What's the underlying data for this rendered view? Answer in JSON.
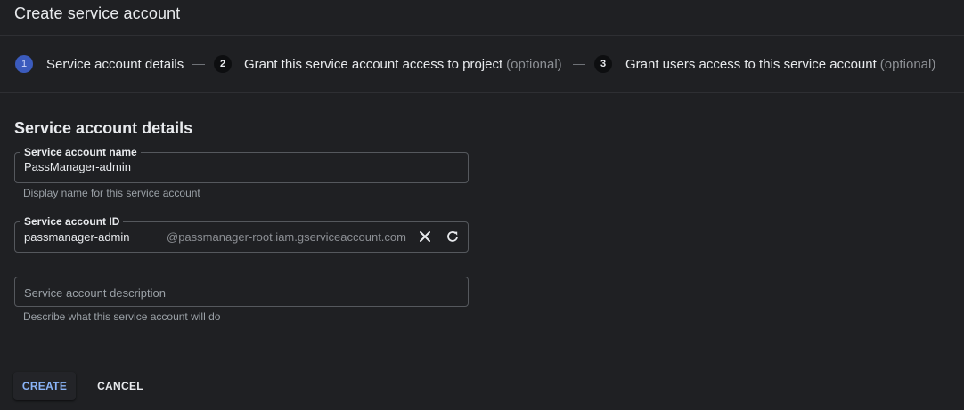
{
  "header": {
    "title": "Create service account"
  },
  "stepper": {
    "steps": [
      {
        "number": "1",
        "label": "Service account details",
        "optional": "",
        "active": true
      },
      {
        "number": "2",
        "label": "Grant this service account access to project",
        "optional": "(optional)",
        "active": false
      },
      {
        "number": "3",
        "label": "Grant users access to this service account",
        "optional": "(optional)",
        "active": false
      }
    ]
  },
  "form": {
    "section_title": "Service account details",
    "name_field": {
      "label": "Service account name",
      "value": "PassManager-admin",
      "hint": "Display name for this service account"
    },
    "id_field": {
      "label": "Service account ID",
      "value": "passmanager-admin",
      "suffix": "@passmanager-root.iam.gserviceaccount.com",
      "clear_icon": "close-icon",
      "refresh_icon": "refresh-icon"
    },
    "description_field": {
      "placeholder": "Service account description",
      "hint": "Describe what this service account will do"
    }
  },
  "actions": {
    "create_label": "CREATE",
    "cancel_label": "CANCEL"
  },
  "colors": {
    "background": "#1f2023",
    "accent": "#8ab4f8",
    "active_step": "#3b5bbd"
  }
}
